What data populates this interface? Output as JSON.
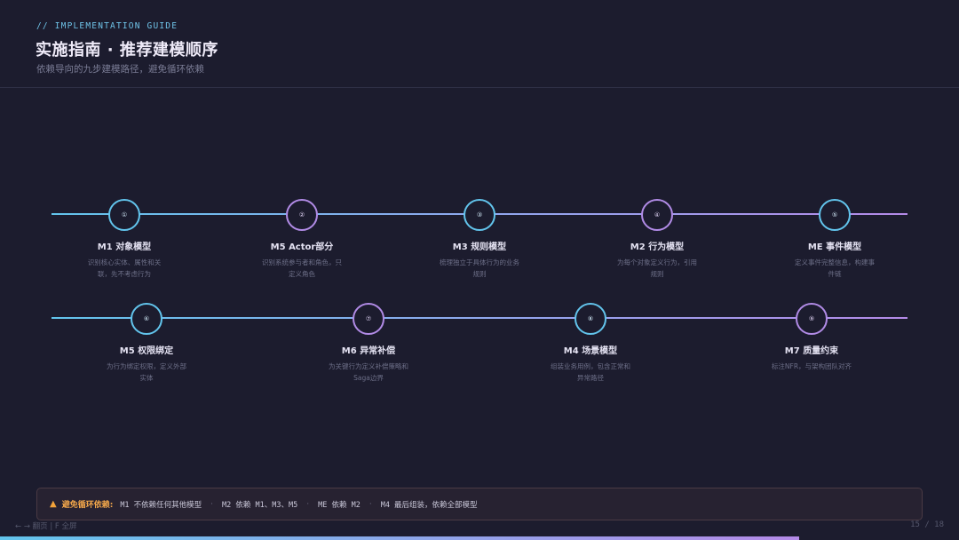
{
  "header": {
    "kicker": "// IMPLEMENTATION GUIDE",
    "title": "实施指南 · 推荐建模顺序",
    "subtitle": "依赖导向的九步建模路径，避免循环依赖"
  },
  "steps_row1": [
    {
      "num": "①",
      "title": "M1 对象模型",
      "desc": "识别核心实体、属性和关联，先不考虑行为",
      "color": "#62c4ec"
    },
    {
      "num": "②",
      "title": "M5 Actor部分",
      "desc": "识别系统参与者和角色，只定义角色",
      "color": "#b18be6"
    },
    {
      "num": "③",
      "title": "M3 规则模型",
      "desc": "梳理独立于具体行为的业务规则",
      "color": "#62c4ec"
    },
    {
      "num": "④",
      "title": "M2 行为模型",
      "desc": "为每个对象定义行为，引用规则",
      "color": "#b18be6"
    },
    {
      "num": "⑤",
      "title": "ME 事件模型",
      "desc": "定义事件完整信息，构建事件链",
      "color": "#62c4ec"
    }
  ],
  "steps_row2": [
    {
      "num": "⑥",
      "title": "M5 权限绑定",
      "desc": "为行为绑定权限，定义外部实体",
      "color": "#62c4ec"
    },
    {
      "num": "⑦",
      "title": "M6 异常补偿",
      "desc": "为关键行为定义补偿策略和Saga边界",
      "color": "#b18be6"
    },
    {
      "num": "⑧",
      "title": "M4 场景模型",
      "desc": "组装业务用例，包含正常和异常路径",
      "color": "#62c4ec"
    },
    {
      "num": "⑨",
      "title": "M7 质量约束",
      "desc": "标注NFR，与架构团队对齐",
      "color": "#b18be6"
    }
  ],
  "warning": {
    "icon": "warning-icon",
    "label": "避免循环依赖:",
    "items": [
      "M1 不依赖任何其他模型",
      "M2 依赖 M1、M3、M5",
      "ME 依赖 M2",
      "M4 最后组装，依赖全部模型"
    ],
    "separator": "·"
  },
  "footer": {
    "nav_hint": "← → 翻页 | F 全屏",
    "page": "15 / 18",
    "progress": 0.833
  },
  "colors": {
    "accent_blue": "#62c4ec",
    "accent_purple": "#b18be6",
    "warning": "#f0a54a",
    "background": "#1c1c2e"
  }
}
